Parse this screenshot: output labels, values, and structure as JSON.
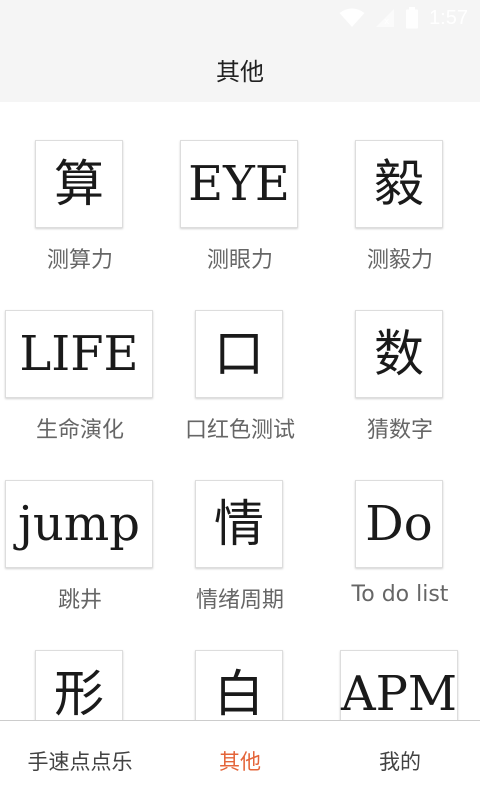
{
  "status_bar": {
    "time": "1:57",
    "icons": [
      "wifi-icon",
      "signal-icon",
      "battery-icon"
    ]
  },
  "header": {
    "title": "其他"
  },
  "tools": [
    {
      "glyph": "算",
      "label": "测算力"
    },
    {
      "glyph": "EYE",
      "label": "测眼力"
    },
    {
      "glyph": "毅",
      "label": "测毅力"
    },
    {
      "glyph": "LIFE",
      "label": "生命演化"
    },
    {
      "glyph": "口",
      "label": "口红色测试"
    },
    {
      "glyph": "数",
      "label": "猜数字"
    },
    {
      "glyph": "jump",
      "label": "跳井"
    },
    {
      "glyph": "情",
      "label": "情绪周期"
    },
    {
      "glyph": "Do",
      "label": "To do list"
    },
    {
      "glyph": "形",
      "label": ""
    },
    {
      "glyph": "白",
      "label": ""
    },
    {
      "glyph": "APM",
      "label": ""
    }
  ],
  "tab_bar": {
    "tabs": [
      {
        "label": "手速点点乐"
      },
      {
        "label": "其他"
      },
      {
        "label": "我的"
      }
    ],
    "active_index": 1
  },
  "colors": {
    "accent": "#e4653a",
    "header_bg": "#f5f5f5",
    "label_text": "#666666",
    "tab_text": "#424242"
  }
}
